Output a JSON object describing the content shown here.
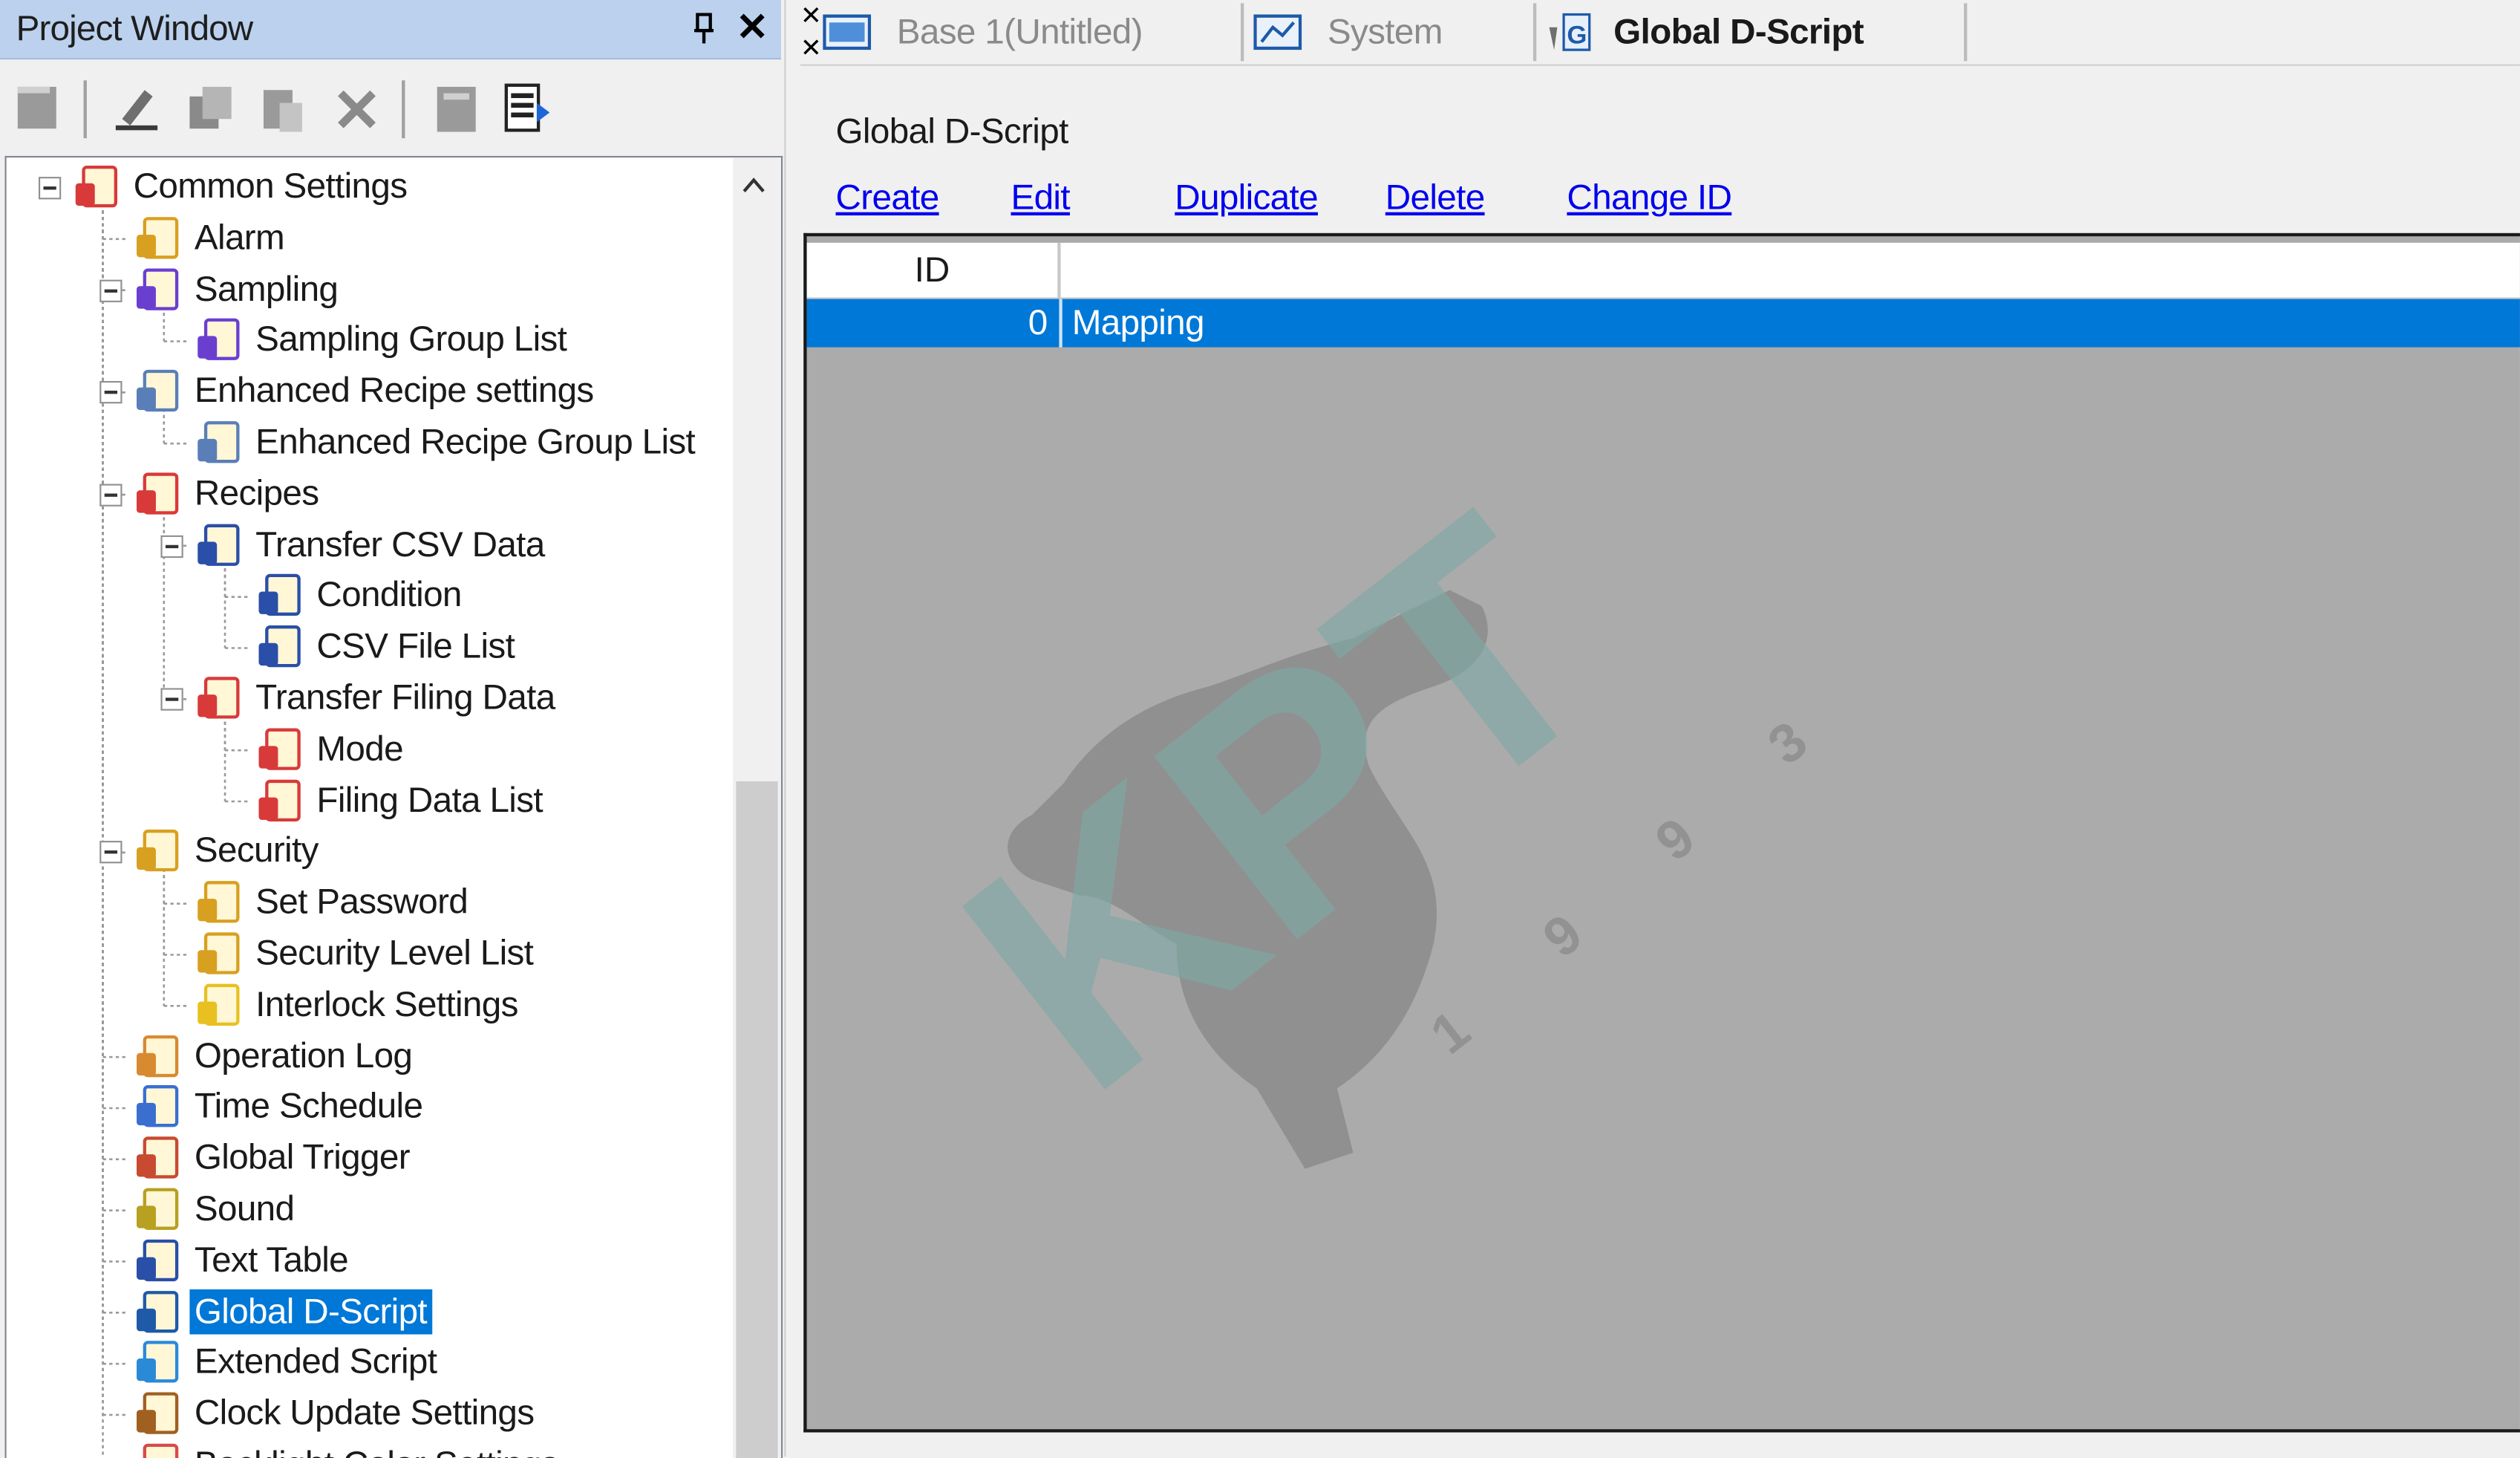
{
  "project_window": {
    "title": "Project Window",
    "toolbar_icons": [
      "new-icon",
      "edit-pen-icon",
      "copy-icon",
      "paste-icon",
      "delete-icon",
      "properties-icon",
      "export-icon"
    ],
    "tree": [
      {
        "label": "Common Settings",
        "icon": "common-settings-icon",
        "level": 0,
        "expander": true
      },
      {
        "label": "Alarm",
        "icon": "alarm-icon",
        "level": 1,
        "expander": false
      },
      {
        "label": "Sampling",
        "icon": "sampling-icon",
        "level": 1,
        "expander": true
      },
      {
        "label": "Sampling Group List",
        "icon": "sampling-icon",
        "level": 2,
        "expander": false
      },
      {
        "label": "Enhanced Recipe settings",
        "icon": "recipe-settings-icon",
        "level": 1,
        "expander": true
      },
      {
        "label": "Enhanced Recipe Group List",
        "icon": "recipe-settings-icon",
        "level": 2,
        "expander": false
      },
      {
        "label": "Recipes",
        "icon": "recipes-icon",
        "level": 1,
        "expander": true
      },
      {
        "label": "Transfer CSV Data",
        "icon": "csv-icon",
        "level": 2,
        "expander": true
      },
      {
        "label": "Condition",
        "icon": "csv-icon",
        "level": 3,
        "expander": false
      },
      {
        "label": "CSV File List",
        "icon": "csv-icon",
        "level": 3,
        "expander": false
      },
      {
        "label": "Transfer Filing Data",
        "icon": "recipes-icon",
        "level": 2,
        "expander": true
      },
      {
        "label": "Mode",
        "icon": "recipes-icon",
        "level": 3,
        "expander": false
      },
      {
        "label": "Filing Data List",
        "icon": "recipes-icon",
        "level": 3,
        "expander": false
      },
      {
        "label": "Security",
        "icon": "key-icon",
        "level": 1,
        "expander": true
      },
      {
        "label": "Set Password",
        "icon": "key-icon",
        "level": 2,
        "expander": false
      },
      {
        "label": "Security Level List",
        "icon": "key-icon",
        "level": 2,
        "expander": false
      },
      {
        "label": "Interlock Settings",
        "icon": "interlock-icon",
        "level": 2,
        "expander": false
      },
      {
        "label": "Operation Log",
        "icon": "operation-log-icon",
        "level": 1,
        "expander": false
      },
      {
        "label": "Time Schedule",
        "icon": "time-schedule-icon",
        "level": 1,
        "expander": false
      },
      {
        "label": "Global Trigger",
        "icon": "trigger-icon",
        "level": 1,
        "expander": false
      },
      {
        "label": "Sound",
        "icon": "sound-icon",
        "level": 1,
        "expander": false
      },
      {
        "label": "Text Table",
        "icon": "text-table-icon",
        "level": 1,
        "expander": false
      },
      {
        "label": "Global D-Script",
        "icon": "dscript-icon",
        "level": 1,
        "expander": false,
        "selected": true
      },
      {
        "label": "Extended Script",
        "icon": "extended-script-icon",
        "level": 1,
        "expander": false
      },
      {
        "label": "Clock Update Settings",
        "icon": "clock-update-icon",
        "level": 1,
        "expander": false
      },
      {
        "label": "Backlight Color Settings",
        "icon": "backlight-icon",
        "level": 1,
        "expander": false
      }
    ]
  },
  "tabs": [
    {
      "label": "Base 1(Untitled)",
      "icon": "screen-icon",
      "active": false
    },
    {
      "label": "System",
      "icon": "system-icon",
      "active": false
    },
    {
      "label": "Global D-Script",
      "icon": "dscript-icon",
      "active": true
    }
  ],
  "content": {
    "title": "Global D-Script",
    "actions": [
      "Create",
      "Edit",
      "Duplicate",
      "Delete",
      "Change ID"
    ],
    "grid": {
      "columns": [
        "ID",
        ""
      ],
      "rows": [
        {
          "id": "0",
          "name": "Mapping",
          "selected": true
        }
      ]
    },
    "watermark": {
      "text": "KPT",
      "digits": [
        "1",
        "9",
        "9",
        "3"
      ]
    }
  },
  "colors": {
    "selection": "#0078d7",
    "link": "#0000ee",
    "title_bar": "#bcd1ee",
    "grid_bg": "#ababab",
    "watermark": "#7fa9a5"
  }
}
